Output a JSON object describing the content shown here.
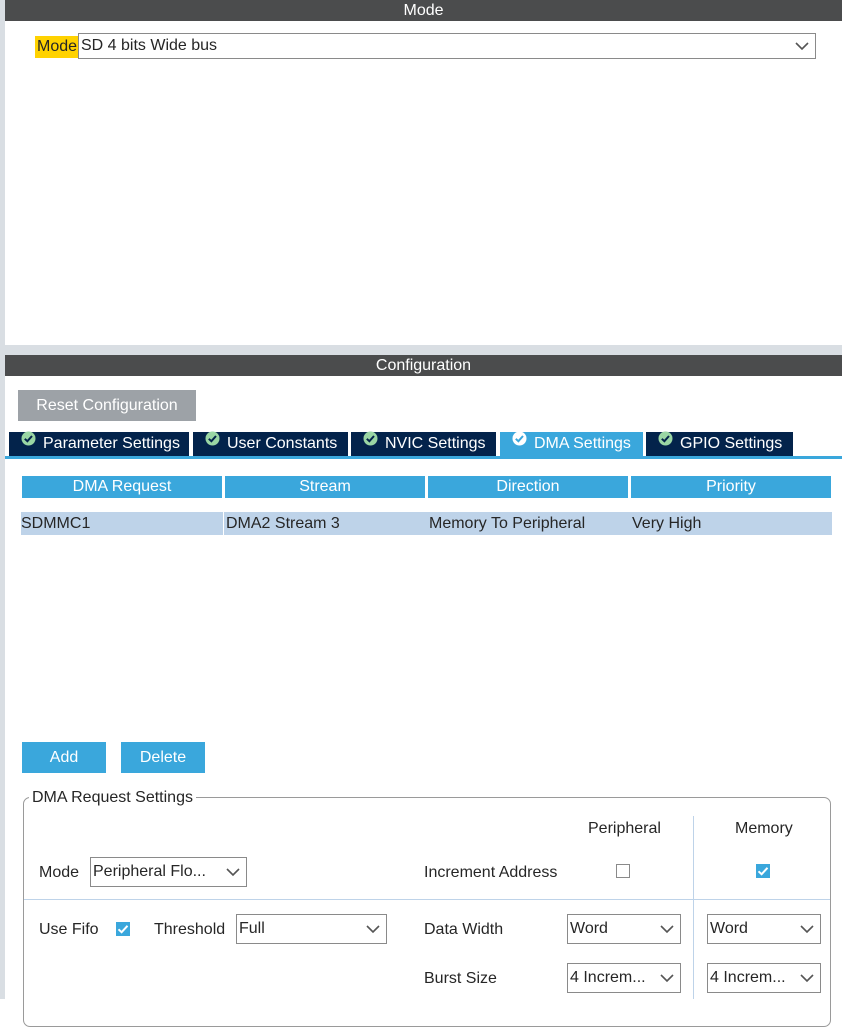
{
  "mode_section": {
    "title": "Mode",
    "mode_label": "Mode",
    "mode_value": "SD 4 bits Wide bus"
  },
  "config_section": {
    "title": "Configuration",
    "reset_button": "Reset Configuration",
    "tabs": [
      {
        "label": "Parameter Settings",
        "active": false
      },
      {
        "label": "User Constants",
        "active": false
      },
      {
        "label": "NVIC Settings",
        "active": false
      },
      {
        "label": "DMA Settings",
        "active": true
      },
      {
        "label": "GPIO Settings",
        "active": false
      }
    ],
    "table": {
      "headers": [
        "DMA Request",
        "Stream",
        "Direction",
        "Priority"
      ],
      "rows": [
        [
          "SDMMC1",
          "DMA2 Stream 3",
          "Memory To Peripheral",
          "Very High"
        ]
      ]
    },
    "add_button": "Add",
    "delete_button": "Delete"
  },
  "dma_request_settings": {
    "title": "DMA Request Settings",
    "col_peripheral": "Peripheral",
    "col_memory": "Memory",
    "mode_label": "Mode",
    "mode_value": "Peripheral Flo...",
    "increment_address_label": "Increment Address",
    "increment_peripheral_checked": false,
    "increment_memory_checked": true,
    "use_fifo_label": "Use Fifo",
    "use_fifo_checked": true,
    "threshold_label": "Threshold",
    "threshold_value": "Full",
    "data_width_label": "Data Width",
    "data_width_peripheral": "Word",
    "data_width_memory": "Word",
    "burst_size_label": "Burst Size",
    "burst_size_peripheral": "4 Increm...",
    "burst_size_memory": "4 Increm..."
  },
  "colors": {
    "accent": "#3aa7dc",
    "tab_dark": "#03234b",
    "header_bar": "#4b4c4d",
    "highlight": "#ffd200",
    "row_selected": "#bed3e9"
  }
}
